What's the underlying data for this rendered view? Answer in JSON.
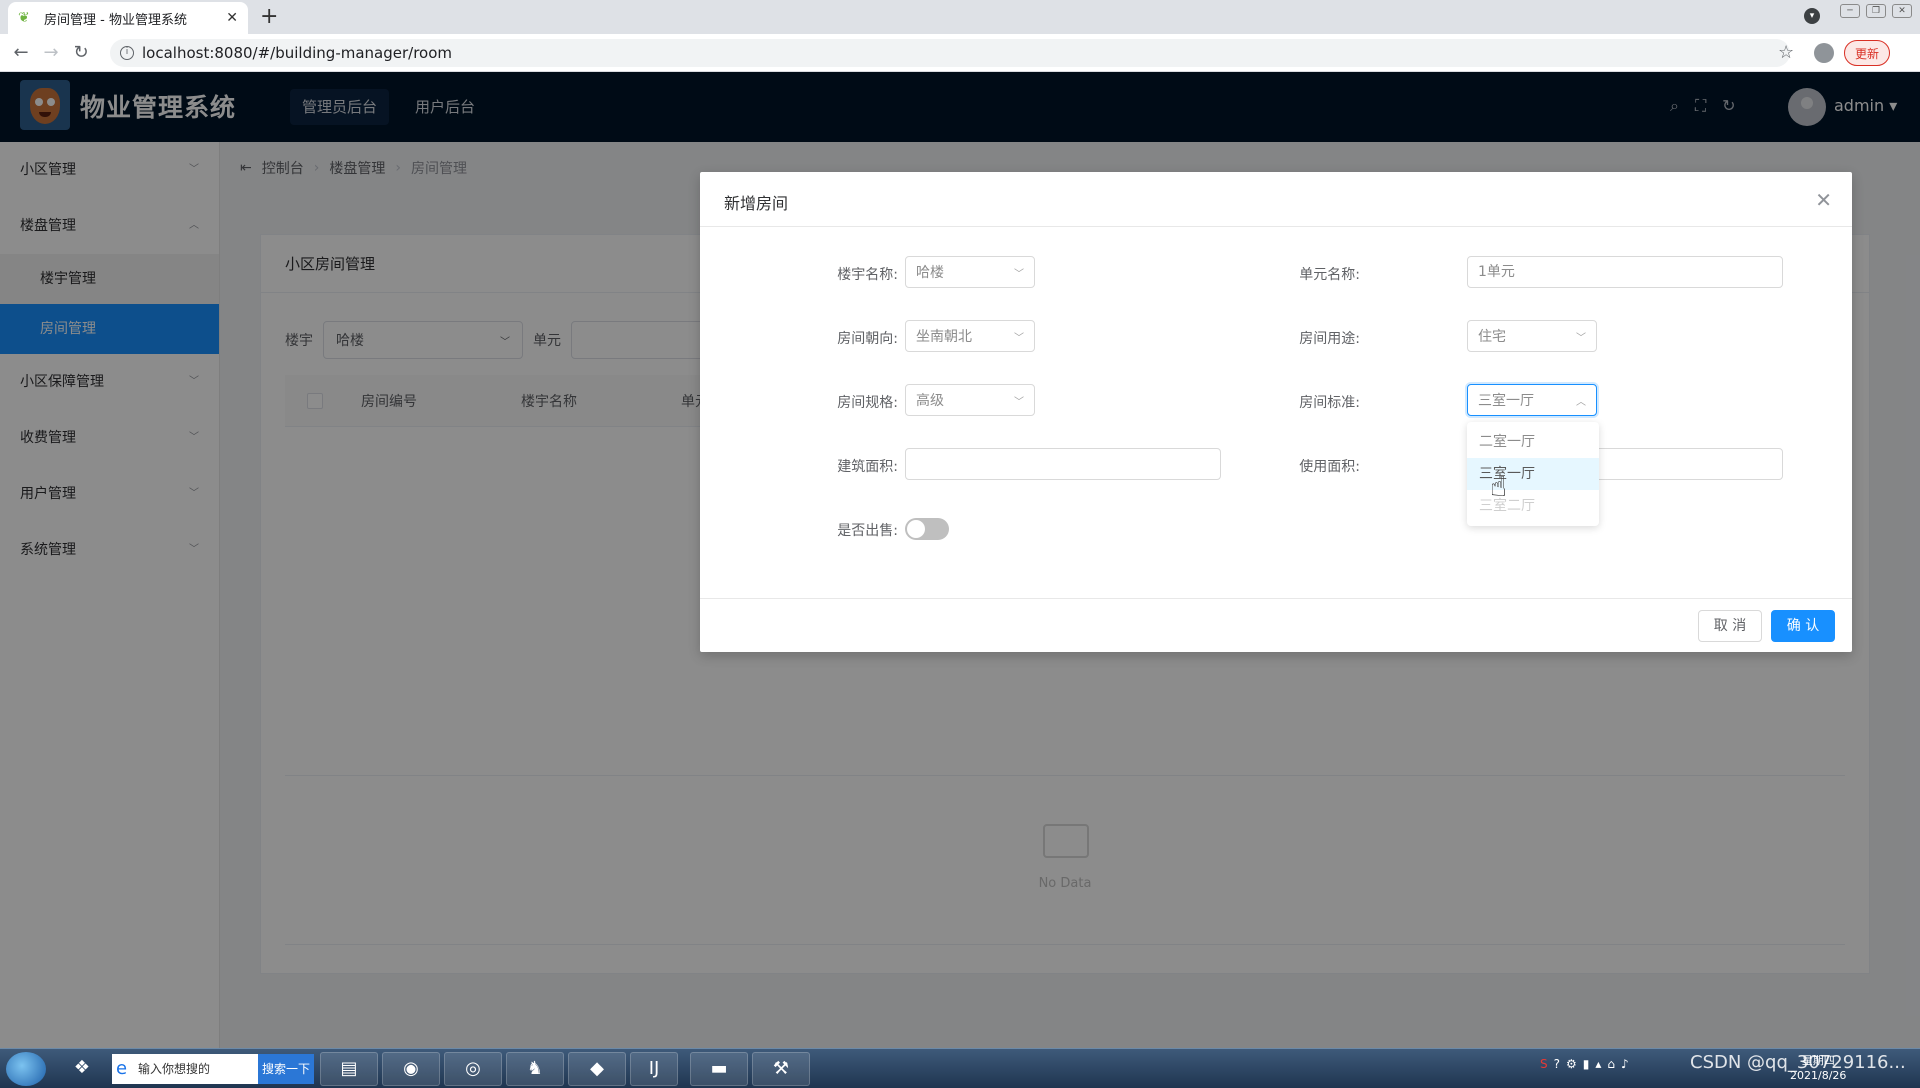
{
  "browser": {
    "tab_title": "房间管理 - 物业管理系统",
    "url": "localhost:8080/#/building-manager/room",
    "update_label": "更新"
  },
  "header": {
    "app_title": "物业管理系统",
    "top_menu": [
      "管理员后台",
      "用户后台"
    ],
    "user": "admin"
  },
  "sidebar": {
    "items": [
      {
        "label": "小区管理"
      },
      {
        "label": "楼盘管理"
      },
      {
        "label": "楼宇管理"
      },
      {
        "label": "房间管理"
      },
      {
        "label": "小区保障管理"
      },
      {
        "label": "收费管理"
      },
      {
        "label": "用户管理"
      },
      {
        "label": "系统管理"
      }
    ]
  },
  "breadcrumb": [
    "控制台",
    "楼盘管理",
    "房间管理"
  ],
  "card": {
    "title": "小区房间管理",
    "filter_building_label": "楼宇",
    "filter_building_value": "哈楼",
    "filter_unit_label": "单元",
    "columns": [
      "房间编号",
      "楼宇名称",
      "单元"
    ],
    "empty_text": "No Data"
  },
  "dialog": {
    "title": "新增房间",
    "fields": {
      "building_label": "楼宇名称:",
      "building_value": "哈楼",
      "unit_label": "单元名称:",
      "unit_value": "1单元",
      "orientation_label": "房间朝向:",
      "orientation_value": "坐南朝北",
      "usage_label": "房间用途:",
      "usage_value": "住宅",
      "spec_label": "房间规格:",
      "spec_value": "高级",
      "standard_label": "房间标准:",
      "standard_value": "三室一厅",
      "build_area_label": "建筑面积:",
      "use_area_label": "使用面积:",
      "sold_label": "是否出售:"
    },
    "dropdown_options": [
      "二室一厅",
      "三室一厅",
      "三室二厅"
    ],
    "cancel_label": "取 消",
    "ok_label": "确 认"
  },
  "taskbar": {
    "search_placeholder": "输入你想搜的",
    "search_button": "搜索一下",
    "clock_time": "星期四",
    "clock_date": "2021/8/26",
    "watermark": "CSDN @qq_30729116..."
  }
}
